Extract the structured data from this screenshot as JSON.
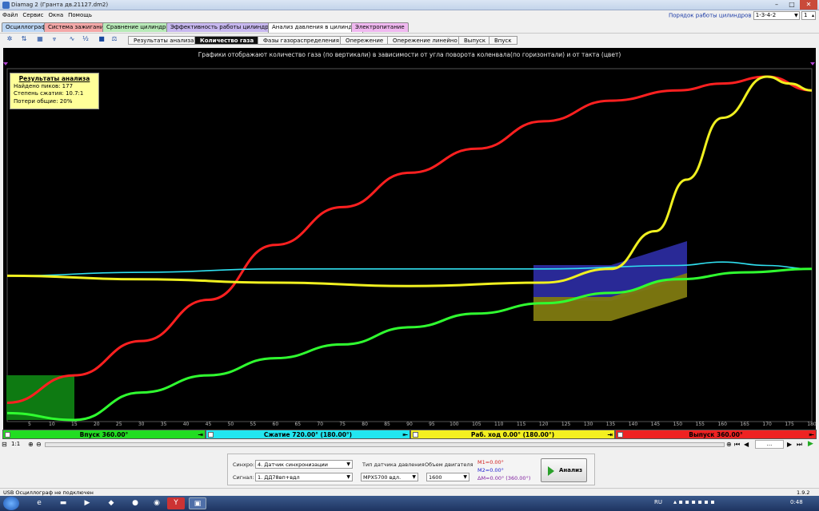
{
  "window": {
    "title": "Diamag 2 (Гранта дв.21127.dm2)",
    "controls": [
      "–",
      "□",
      "✕"
    ]
  },
  "menu": {
    "items": [
      "Файл",
      "Сервис",
      "Окна",
      "Помощь"
    ],
    "cylinder_order_label": "Порядок работы цилиндров",
    "cylinder_order_value": "1-3-4-2",
    "cylinder_index": "1"
  },
  "tabs_main": [
    {
      "label": "Осциллограф",
      "color": "#bcd6f4"
    },
    {
      "label": "Система зажигания",
      "color": "#f4a8a8"
    },
    {
      "label": "Сравнение цилиндров",
      "color": "#b8eab8"
    },
    {
      "label": "Эффективность работы цилиндров",
      "color": "#c8b8f0"
    },
    {
      "label": "Анализ давления в цилиндре",
      "color": "#ffffff"
    },
    {
      "label": "Электропитание",
      "color": "#f0b8f0"
    }
  ],
  "tabs_sub": [
    {
      "label": "Результаты анализа",
      "active": false
    },
    {
      "label": "Количество газа",
      "active": true
    },
    {
      "label": "Фазы газораспределения",
      "active": false
    },
    {
      "label": "Опережение",
      "active": false
    },
    {
      "label": "Опережение линейно",
      "active": false
    },
    {
      "label": "Выпуск",
      "active": false
    },
    {
      "label": "Впуск",
      "active": false
    }
  ],
  "chart_caption": "Графики отображают количество газа (по вертикали) в зависимости от угла поворота коленвала(по горизонтали) и от такта (цвет)",
  "results": {
    "title": "Результаты анализа",
    "peaks": "Найдено пиков: 177",
    "compression": "Степень сжатия: 10.7:1",
    "losses": "Потери общие: 20%"
  },
  "chart_data": {
    "type": "line",
    "title": "",
    "xlabel": "",
    "ylabel": "",
    "xlim": [
      0,
      180
    ],
    "x_ticks": [
      5,
      10,
      15,
      20,
      25,
      30,
      35,
      40,
      45,
      50,
      55,
      60,
      65,
      70,
      75,
      80,
      85,
      90,
      95,
      100,
      105,
      110,
      115,
      120,
      125,
      130,
      135,
      140,
      145,
      150,
      155,
      160,
      165,
      170,
      175,
      180
    ],
    "series": [
      {
        "name": "Выпуск",
        "color": "#ff2020",
        "x": [
          0,
          15,
          30,
          45,
          60,
          75,
          90,
          105,
          120,
          135,
          150,
          160,
          170,
          180
        ],
        "y": [
          0.05,
          0.13,
          0.23,
          0.35,
          0.51,
          0.62,
          0.72,
          0.79,
          0.87,
          0.93,
          0.96,
          0.98,
          1.0,
          0.96
        ]
      },
      {
        "name": "Сжатие",
        "color": "#30e0f0",
        "x": [
          0,
          30,
          60,
          90,
          120,
          150,
          160,
          170,
          180
        ],
        "y": [
          0.42,
          0.43,
          0.44,
          0.44,
          0.44,
          0.45,
          0.46,
          0.45,
          0.44
        ]
      },
      {
        "name": "Раб. ход",
        "color": "#f0f020",
        "x": [
          0,
          30,
          60,
          90,
          120,
          135,
          145,
          152,
          160,
          170,
          175,
          180
        ],
        "y": [
          0.42,
          0.41,
          0.4,
          0.39,
          0.4,
          0.44,
          0.55,
          0.7,
          0.88,
          1.0,
          0.98,
          0.96
        ]
      },
      {
        "name": "Впуск",
        "color": "#30ff30",
        "x": [
          0,
          15,
          30,
          45,
          60,
          75,
          90,
          105,
          120,
          135,
          150,
          165,
          180
        ],
        "y": [
          0.02,
          0.0,
          0.08,
          0.13,
          0.18,
          0.22,
          0.27,
          0.31,
          0.34,
          0.37,
          0.41,
          0.43,
          0.44
        ]
      }
    ]
  },
  "phases": [
    {
      "label": "Впуск 360.00°",
      "color": "#22dd22"
    },
    {
      "label": "Сжатие 720.00° (180.00°)",
      "color": "#22e6f0"
    },
    {
      "label": "Раб. ход 0.00° (180.00°)",
      "color": "#f4f020"
    },
    {
      "label": "Выпуск 360.00°",
      "color": "#ee2222"
    }
  ],
  "nav": {
    "zoom": "1:1",
    "dots": "..."
  },
  "settings": {
    "sync_label": "Синхро:",
    "sync_value": "4. Датчик синхронизации",
    "signal_label": "Сигнал:",
    "signal_value": "1. ДД78вп+вдл",
    "sensor_label": "Тип датчика давления",
    "sensor_value": "MPX5700 вдл.",
    "volume_label": "Объем двигателя",
    "volume_value": "1600",
    "m1": "M1=0.00°",
    "m2": "M2=0.00°",
    "dm": "ΔM=0.00° (360.00°)",
    "analyze_label": "Анализ"
  },
  "status": {
    "left": "USB Осциллограф не подключен",
    "version": "1.9.2"
  },
  "taskbar": {
    "lang": "RU",
    "time": "0:48"
  }
}
